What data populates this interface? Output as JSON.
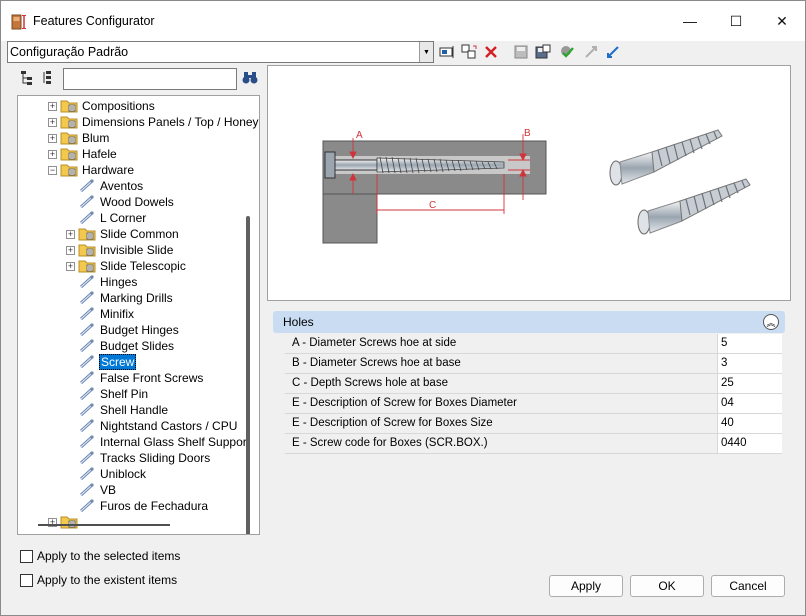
{
  "window": {
    "title": "Features Configurator",
    "minimize_glyph": "—",
    "maximize_glyph": "☐",
    "close_glyph": "✕"
  },
  "toolbar": {
    "configuration_value": "Configuração Padrão",
    "icons": [
      "rename-icon",
      "copy-config-icon",
      "delete-icon",
      "save-icon",
      "save-as-icon",
      "apply-green-icon",
      "collapse-arrows-icon",
      "expand-arrows-icon"
    ]
  },
  "tree_toolbar": {
    "search_value": "",
    "icons": [
      "tree-expand-icon",
      "tree-collapse-icon",
      "binoculars-icon"
    ]
  },
  "tree": {
    "items": [
      {
        "label": "Compositions",
        "type": "folder",
        "level": 1,
        "expander": "+"
      },
      {
        "label": "Dimensions Panels / Top / Honey",
        "type": "folder",
        "level": 1,
        "expander": "+"
      },
      {
        "label": "Blum",
        "type": "folder",
        "level": 1,
        "expander": "+"
      },
      {
        "label": "Hafele",
        "type": "folder",
        "level": 1,
        "expander": "+"
      },
      {
        "label": "Hardware",
        "type": "folder",
        "level": 1,
        "expander": "−"
      },
      {
        "label": "Aventos",
        "type": "item",
        "level": 2
      },
      {
        "label": "Wood Dowels",
        "type": "item",
        "level": 2
      },
      {
        "label": "L Corner",
        "type": "item",
        "level": 2
      },
      {
        "label": "Slide Common",
        "type": "folder",
        "level": 2,
        "expander": "+"
      },
      {
        "label": "Invisible Slide",
        "type": "folder",
        "level": 2,
        "expander": "+"
      },
      {
        "label": "Slide Telescopic",
        "type": "folder",
        "level": 2,
        "expander": "+"
      },
      {
        "label": "Hinges",
        "type": "item",
        "level": 2
      },
      {
        "label": "Marking Drills",
        "type": "item",
        "level": 2
      },
      {
        "label": "Minifix",
        "type": "item",
        "level": 2
      },
      {
        "label": "Budget Hinges",
        "type": "item",
        "level": 2
      },
      {
        "label": "Budget Slides",
        "type": "item",
        "level": 2
      },
      {
        "label": "Screw",
        "type": "item",
        "level": 2,
        "selected": true
      },
      {
        "label": "False Front Screws",
        "type": "item",
        "level": 2
      },
      {
        "label": "Shelf Pin",
        "type": "item",
        "level": 2
      },
      {
        "label": "Shell Handle",
        "type": "item",
        "level": 2
      },
      {
        "label": "Nightstand Castors  / CPU",
        "type": "item",
        "level": 2
      },
      {
        "label": "Internal Glass Shelf Support",
        "type": "item",
        "level": 2
      },
      {
        "label": "Tracks Sliding Doors",
        "type": "item",
        "level": 2
      },
      {
        "label": "Uniblock",
        "type": "item",
        "level": 2
      },
      {
        "label": "VB",
        "type": "item",
        "level": 2
      },
      {
        "label": "Furos de Fechadura",
        "type": "item",
        "level": 2
      },
      {
        "label": "",
        "type": "folder",
        "level": 1,
        "expander": "+"
      }
    ]
  },
  "preview": {
    "label_a": "A",
    "label_b": "B",
    "label_c": "C"
  },
  "properties": {
    "group_title": "Holes",
    "rows": [
      {
        "label": "A - Diameter Screws hoe at side",
        "value": "5"
      },
      {
        "label": "B - Diameter Screws hoe at base",
        "value": "3"
      },
      {
        "label": "C - Depth Screws hole at base",
        "value": "25"
      },
      {
        "label": "E - Description of Screw for Boxes Diameter",
        "value": "04"
      },
      {
        "label": "E - Description of Screw for Boxes Size",
        "value": "40"
      },
      {
        "label": "E - Screw code for Boxes (SCR.BOX.)",
        "value": "0440"
      }
    ]
  },
  "options": {
    "apply_selected": "Apply to the selected items",
    "apply_existent": "Apply to the existent items"
  },
  "buttons": {
    "apply": "Apply",
    "ok": "OK",
    "cancel": "Cancel"
  },
  "colors": {
    "selection": "#0078d7",
    "group_header": "#c9dcf2",
    "folder": "#f2c94c",
    "dimension_red": "#d0343a"
  }
}
